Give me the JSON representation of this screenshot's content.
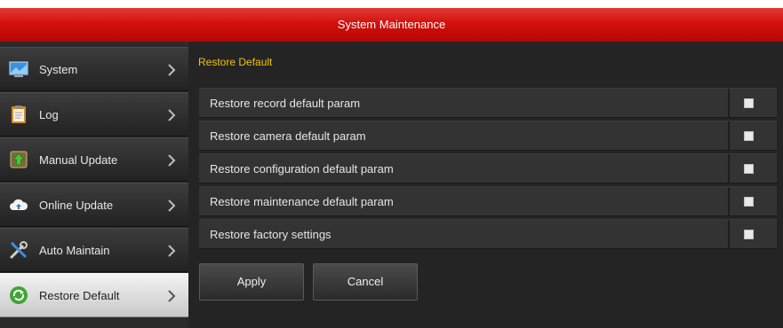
{
  "window": {
    "title": "System Maintenance"
  },
  "sidebar": {
    "items": [
      {
        "label": "System",
        "icon": "monitor-icon",
        "active": false
      },
      {
        "label": "Log",
        "icon": "clipboard-icon",
        "active": false
      },
      {
        "label": "Manual Update",
        "icon": "upload-icon",
        "active": false
      },
      {
        "label": "Online Update",
        "icon": "cloud-icon",
        "active": false
      },
      {
        "label": "Auto Maintain",
        "icon": "tools-icon",
        "active": false
      },
      {
        "label": "Restore Default",
        "icon": "refresh-icon",
        "active": true
      }
    ]
  },
  "main": {
    "section_title": "Restore Default",
    "options": [
      {
        "label": "Restore record default param",
        "checked": false
      },
      {
        "label": "Restore camera default param",
        "checked": false
      },
      {
        "label": "Restore configuration default param",
        "checked": false
      },
      {
        "label": "Restore maintenance default param",
        "checked": false
      },
      {
        "label": "Restore factory settings",
        "checked": false
      }
    ],
    "apply_label": "Apply",
    "cancel_label": "Cancel"
  },
  "colors": {
    "titlebar": "#d2110d",
    "section_title": "#f0c20a",
    "panel_bg": "#242424"
  }
}
